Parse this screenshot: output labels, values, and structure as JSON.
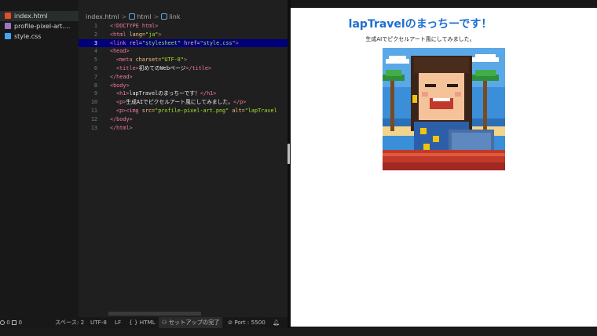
{
  "explorer": {
    "files": [
      {
        "name": "index.html",
        "active": true,
        "icon": "html-file-icon"
      },
      {
        "name": "profile-pixel-art....",
        "active": false,
        "icon": "image-file-icon"
      },
      {
        "name": "style.css",
        "active": false,
        "icon": "css-file-icon"
      }
    ]
  },
  "breadcrumb": {
    "file": "index.html",
    "sep1": ">",
    "item1": "html",
    "sep2": ">",
    "item2": "link"
  },
  "code": {
    "lines": [
      "1",
      "2",
      "3",
      "4",
      "5",
      "6",
      "7",
      "8",
      "9",
      "10",
      "11",
      "12",
      "13"
    ],
    "l1": "<!DOCTYPE html>",
    "l2_tag_open": "<html ",
    "l2_attr": "lang=",
    "l2_str": "\"ja\"",
    "l2_close": ">",
    "l3_tag": "<link ",
    "l3_attr1": "rel=",
    "l3_str1": "\"stylesheet\" ",
    "l3_attr2": "href=",
    "l3_str2": "\"style.css\"",
    "l3_close": ">",
    "l4": "<head>",
    "l5_tag": "<meta ",
    "l5_attr": "charset=",
    "l5_str": "\"UTF-8\"",
    "l5_close": ">",
    "l6_open": "<title>",
    "l6_text": "初めてのWebページ",
    "l6_close": "</title>",
    "l7": "</head>",
    "l8": "<body>",
    "l9_open": "<h1>",
    "l9_text": "lapTravelのまっちーです！",
    "l9_close": "</h1>",
    "l10_open": "<p>",
    "l10_text": "生成AIでピクセルアート風にしてみました。",
    "l10_close": "</p>",
    "l11_open": "<p><img ",
    "l11_attr1": "src=",
    "l11_str1": "\"profile-pixel-art.png\" ",
    "l11_attr2": "alt=",
    "l11_str2": "\"lapTravel",
    "l12": "</body>",
    "l13": "</html>"
  },
  "preview": {
    "heading": "lapTravelのまっちーです！",
    "paragraph": "生成AIでピクセルアート風にしてみました。",
    "image": "profile-pixel-art"
  },
  "statusbar": {
    "problems": "0",
    "warnings": "0",
    "spaces": "スペース: 2",
    "encoding": "UTF-8",
    "eol": "LF",
    "language": "HTML",
    "setup": "セットアップの完了",
    "port": "Port : 5500"
  },
  "colors": {
    "heading": "#1d6fd1",
    "selection": "#00007a",
    "tag": "#f07aa0",
    "attr": "#f4c37a",
    "string": "#a6e22e"
  }
}
